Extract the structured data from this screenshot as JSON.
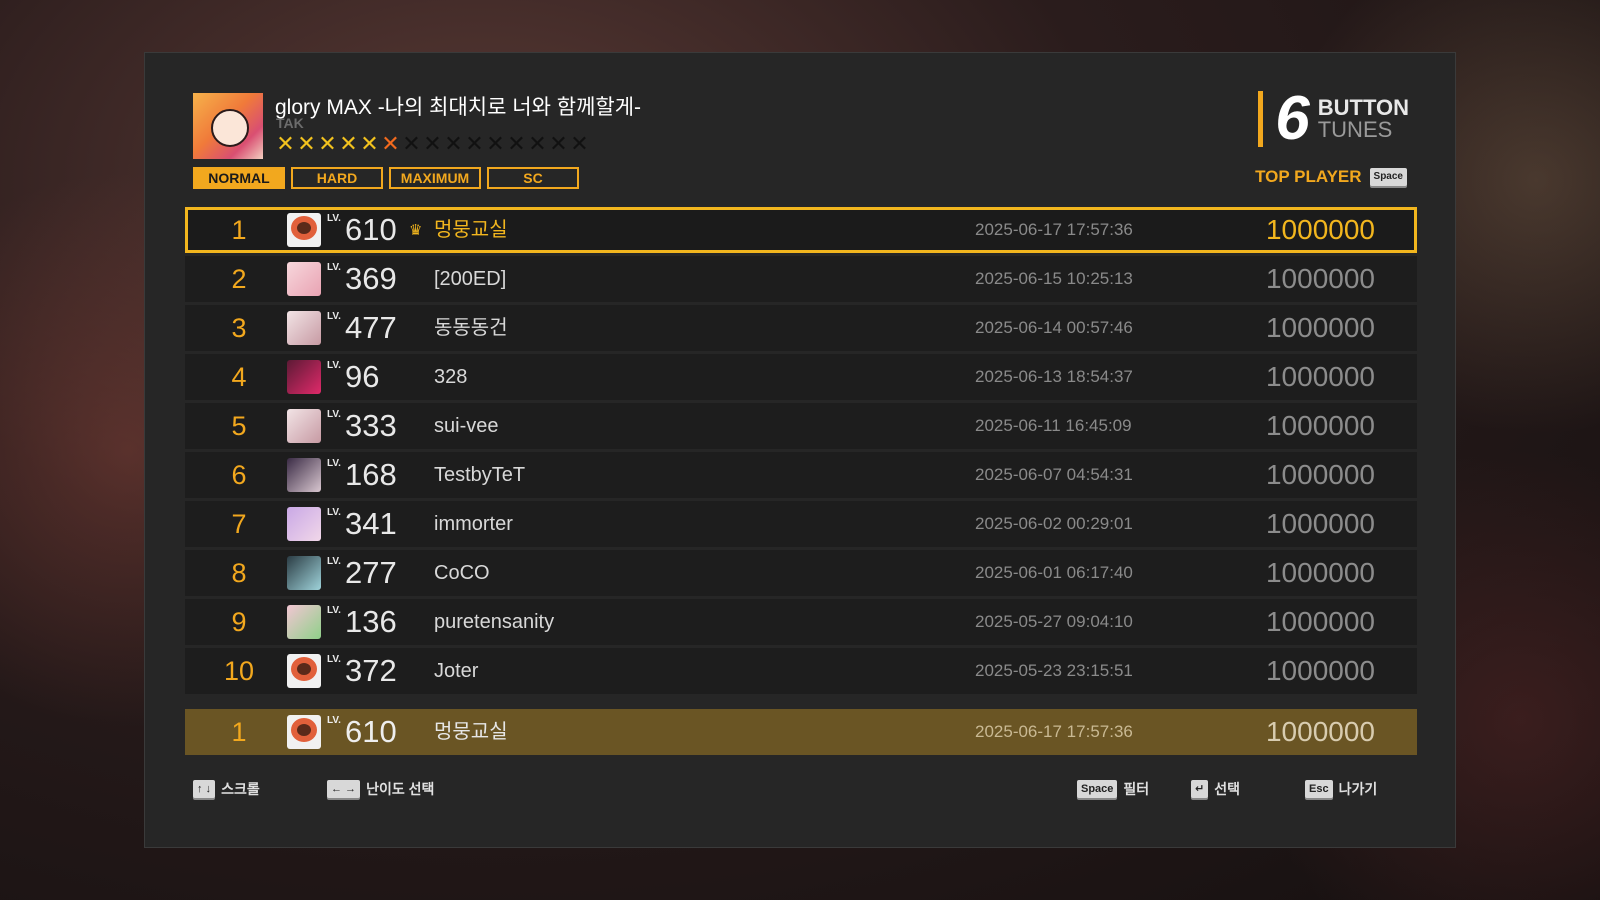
{
  "song": {
    "title": "glory MAX -나의 최대치로 너와 함께할게-",
    "artist": "TAK",
    "difficulty_stars_filled_yellow": 5,
    "difficulty_stars_filled_orange": 1,
    "difficulty_stars_total": 15
  },
  "difficulty_tabs": [
    {
      "label": "NORMAL",
      "active": true
    },
    {
      "label": "HARD",
      "active": false
    },
    {
      "label": "MAXIMUM",
      "active": false
    },
    {
      "label": "SC",
      "active": false
    }
  ],
  "logo": {
    "number": "6",
    "line1": "BUTTON",
    "line2": "TUNES"
  },
  "top_player": {
    "label": "TOP PLAYER",
    "key": "Space"
  },
  "rankings": [
    {
      "rank": "1",
      "lv_label": "LV.",
      "level": "610",
      "crown": true,
      "name": "멍뭉교실",
      "date": "2025-06-17 17:57:36",
      "score": "1000000",
      "avatar": "av-orange"
    },
    {
      "rank": "2",
      "lv_label": "LV.",
      "level": "369",
      "crown": false,
      "name": "[200ED]",
      "date": "2025-06-15 10:25:13",
      "score": "1000000",
      "avatar": "av-pink"
    },
    {
      "rank": "3",
      "lv_label": "LV.",
      "level": "477",
      "crown": false,
      "name": "동동동건",
      "date": "2025-06-14 00:57:46",
      "score": "1000000",
      "avatar": "av-white"
    },
    {
      "rank": "4",
      "lv_label": "LV.",
      "level": "96",
      "crown": false,
      "name": "328",
      "date": "2025-06-13 18:54:37",
      "score": "1000000",
      "avatar": "av-red"
    },
    {
      "rank": "5",
      "lv_label": "LV.",
      "level": "333",
      "crown": false,
      "name": "sui-vee",
      "date": "2025-06-11 16:45:09",
      "score": "1000000",
      "avatar": "av-white"
    },
    {
      "rank": "6",
      "lv_label": "LV.",
      "level": "168",
      "crown": false,
      "name": "TestbyTeT",
      "date": "2025-06-07 04:54:31",
      "score": "1000000",
      "avatar": "av-dark"
    },
    {
      "rank": "7",
      "lv_label": "LV.",
      "level": "341",
      "crown": false,
      "name": "immorter",
      "date": "2025-06-02 00:29:01",
      "score": "1000000",
      "avatar": "av-lilac"
    },
    {
      "rank": "8",
      "lv_label": "LV.",
      "level": "277",
      "crown": false,
      "name": "CoCO",
      "date": "2025-06-01 06:17:40",
      "score": "1000000",
      "avatar": "av-teal"
    },
    {
      "rank": "9",
      "lv_label": "LV.",
      "level": "136",
      "crown": false,
      "name": "puretensanity",
      "date": "2025-05-27 09:04:10",
      "score": "1000000",
      "avatar": "av-green"
    },
    {
      "rank": "10",
      "lv_label": "LV.",
      "level": "372",
      "crown": false,
      "name": "Joter",
      "date": "2025-05-23 23:15:51",
      "score": "1000000",
      "avatar": "av-orange"
    }
  ],
  "my_record": {
    "rank": "1",
    "lv_label": "LV.",
    "level": "610",
    "name": "멍뭉교실",
    "date": "2025-06-17 17:57:36",
    "score": "1000000"
  },
  "footer": {
    "scroll": {
      "keys": "↑ ↓",
      "label": "스크롤"
    },
    "difficulty": {
      "keys": "← →",
      "label": "난이도 선택"
    },
    "filter": {
      "keys": "Space",
      "label": "필터"
    },
    "select": {
      "keys": "↵",
      "label": "선택"
    },
    "exit": {
      "keys": "Esc",
      "label": "나가기"
    }
  },
  "colors": {
    "accent": "#f2a81e",
    "panel": "#262626",
    "row": "#1d1d1d",
    "my_row": "#6a5524"
  }
}
